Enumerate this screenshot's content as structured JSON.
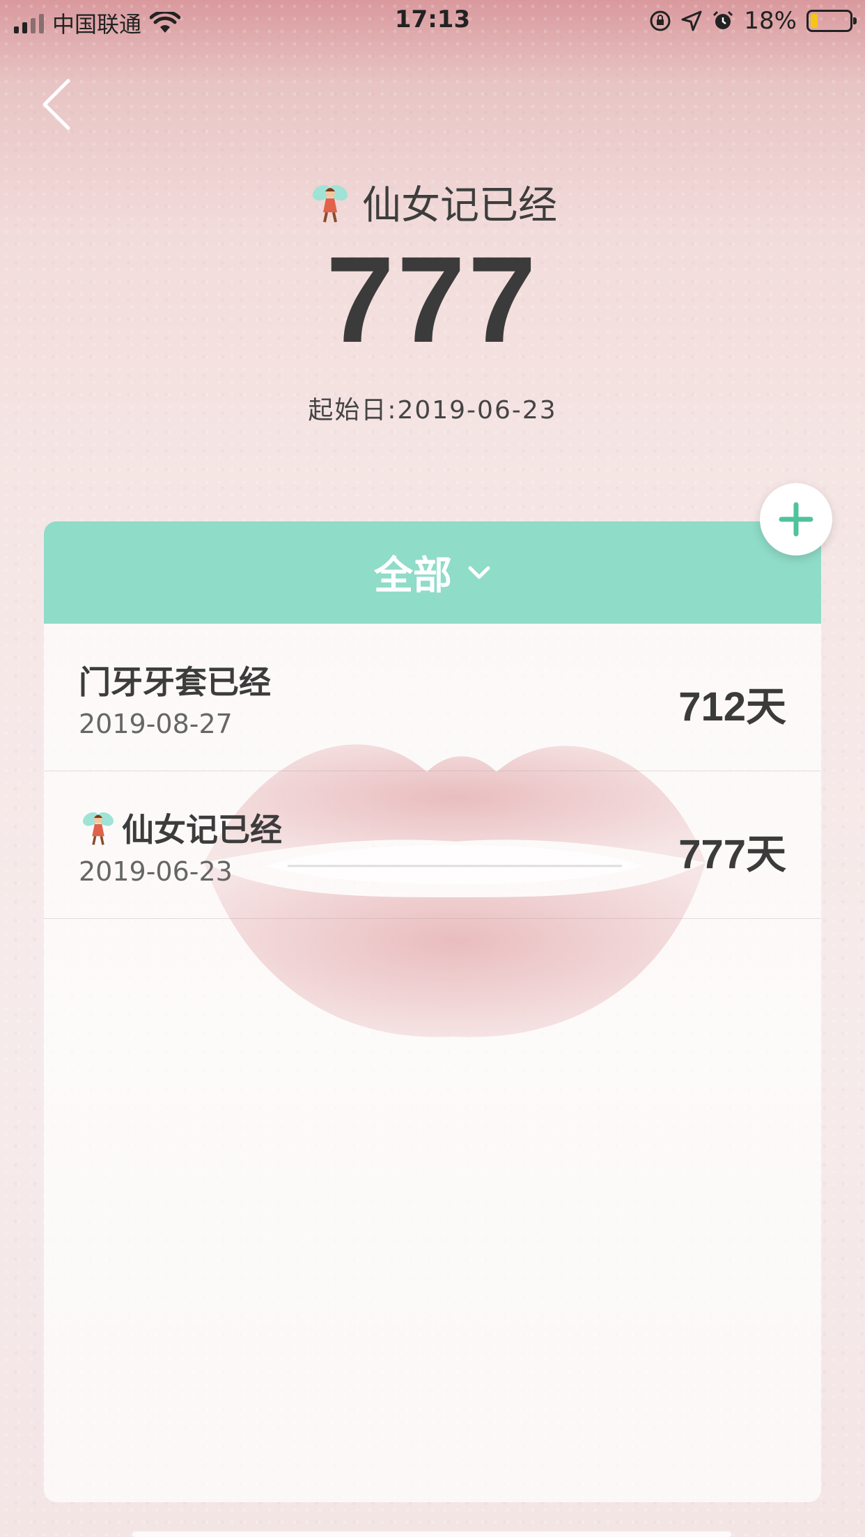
{
  "status_bar": {
    "carrier": "中国联通",
    "time": "17:13",
    "battery_percent": "18%",
    "battery_level": 0.18,
    "icons": [
      "signal-icon",
      "wifi-icon",
      "rotation-lock-icon",
      "location-icon",
      "alarm-icon",
      "battery-icon"
    ]
  },
  "nav": {
    "back_icon": "chevron-left-icon"
  },
  "header": {
    "title": "仙女记已经",
    "count": "777",
    "start_date": "起始日:2019-06-23"
  },
  "filter": {
    "label": "全部",
    "icon": "chevron-down-icon"
  },
  "add_button_icon": "plus-icon",
  "items": [
    {
      "title": "门牙牙套已经",
      "date": "2019-08-27",
      "days": "712天"
    },
    {
      "title": "仙女记已经",
      "date": "2019-06-23",
      "days": "777天",
      "emoji": "fairy-icon"
    }
  ],
  "colors": {
    "accent": "#8fdcc8",
    "plus": "#4fc39d",
    "text": "#3b3b3b"
  }
}
